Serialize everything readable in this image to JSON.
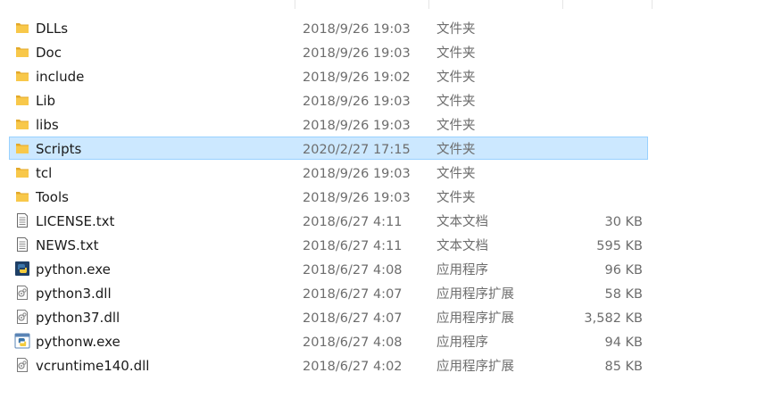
{
  "files": [
    {
      "name": "DLLs",
      "date": "2018/9/26 19:03",
      "type": "文件夹",
      "size": "",
      "icon": "folder-icon",
      "selected": false
    },
    {
      "name": "Doc",
      "date": "2018/9/26 19:03",
      "type": "文件夹",
      "size": "",
      "icon": "folder-icon",
      "selected": false
    },
    {
      "name": "include",
      "date": "2018/9/26 19:02",
      "type": "文件夹",
      "size": "",
      "icon": "folder-icon",
      "selected": false
    },
    {
      "name": "Lib",
      "date": "2018/9/26 19:03",
      "type": "文件夹",
      "size": "",
      "icon": "folder-icon",
      "selected": false
    },
    {
      "name": "libs",
      "date": "2018/9/26 19:03",
      "type": "文件夹",
      "size": "",
      "icon": "folder-icon",
      "selected": false
    },
    {
      "name": "Scripts",
      "date": "2020/2/27 17:15",
      "type": "文件夹",
      "size": "",
      "icon": "folder-icon",
      "selected": true
    },
    {
      "name": "tcl",
      "date": "2018/9/26 19:03",
      "type": "文件夹",
      "size": "",
      "icon": "folder-icon",
      "selected": false
    },
    {
      "name": "Tools",
      "date": "2018/9/26 19:03",
      "type": "文件夹",
      "size": "",
      "icon": "folder-icon",
      "selected": false
    },
    {
      "name": "LICENSE.txt",
      "date": "2018/6/27 4:11",
      "type": "文本文档",
      "size": "30 KB",
      "icon": "text-document-icon",
      "selected": false
    },
    {
      "name": "NEWS.txt",
      "date": "2018/6/27 4:11",
      "type": "文本文档",
      "size": "595 KB",
      "icon": "text-document-icon",
      "selected": false
    },
    {
      "name": "python.exe",
      "date": "2018/6/27 4:08",
      "type": "应用程序",
      "size": "96 KB",
      "icon": "python-icon",
      "selected": false
    },
    {
      "name": "python3.dll",
      "date": "2018/6/27 4:07",
      "type": "应用程序扩展",
      "size": "58 KB",
      "icon": "dll-icon",
      "selected": false
    },
    {
      "name": "python37.dll",
      "date": "2018/6/27 4:07",
      "type": "应用程序扩展",
      "size": "3,582 KB",
      "icon": "dll-icon",
      "selected": false
    },
    {
      "name": "pythonw.exe",
      "date": "2018/6/27 4:08",
      "type": "应用程序",
      "size": "94 KB",
      "icon": "pythonw-icon",
      "selected": false
    },
    {
      "name": "vcruntime140.dll",
      "date": "2018/6/27 4:02",
      "type": "应用程序扩展",
      "size": "85 KB",
      "icon": "dll-icon",
      "selected": false
    }
  ],
  "colors": {
    "selection_background": "#cce8ff",
    "selection_border": "#99d1ff",
    "folder": "#f8c84a",
    "python_blue": "#3b74a8",
    "python_yellow": "#f3cb3c"
  }
}
